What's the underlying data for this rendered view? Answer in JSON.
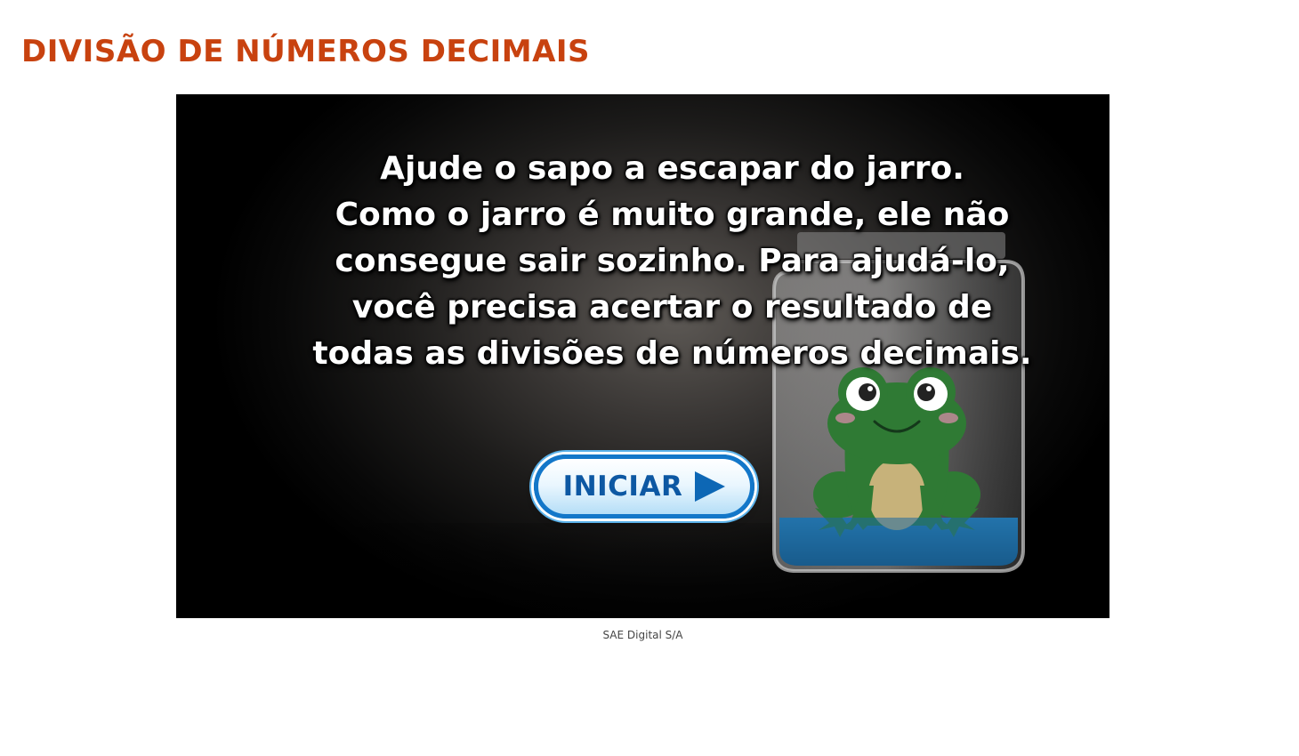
{
  "page": {
    "title": "DIVISÃO DE NÚMEROS DECIMAIS"
  },
  "game": {
    "intro_text": "Ajude o sapo a escapar do jarro.\nComo o jarro é muito grande, ele não\nconsegue sair sozinho. Para ajudá-lo,\nvocê precisa acertar o resultado de\ntodas as divisões de números decimais.",
    "start_button_label": "INICIAR",
    "icons": {
      "start_button": "play-icon",
      "scene": [
        "glass-jar-icon",
        "frog-icon"
      ]
    }
  },
  "footer": {
    "credit": "SAE Digital S/A"
  },
  "colors": {
    "title": "#c8420f",
    "button_border": "#1377c9",
    "button_text": "#0d58a3",
    "frog_green": "#2f7a34",
    "jar_water": "#1e6aa0"
  }
}
